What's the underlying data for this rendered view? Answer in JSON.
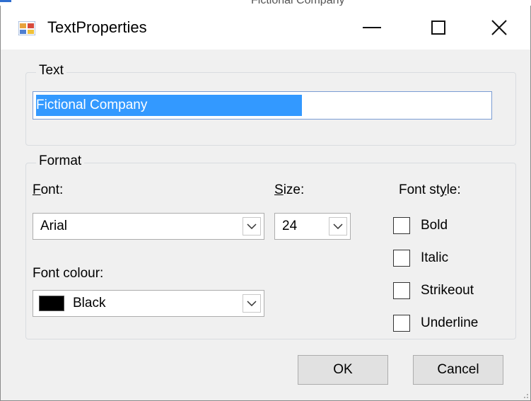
{
  "background_strip": {
    "text": "Fictional Company"
  },
  "window": {
    "title": "TextProperties",
    "controls": {
      "minimize": "minimize-icon",
      "maximize": "maximize-icon",
      "close": "close-icon"
    }
  },
  "text_group": {
    "title": "Text",
    "input_value": "Fictional Company"
  },
  "format_group": {
    "title": "Format",
    "font_label_accel": "F",
    "font_label_rest": "ont:",
    "font_value": "Arial",
    "size_label_accel": "S",
    "size_label_rest": "ize:",
    "size_value": "24",
    "colour_label": "Font colour:",
    "colour_value": "Black",
    "colour_swatch": "#000000",
    "style_label_pre": "Font st",
    "style_label_accel": "y",
    "style_label_post": "le:",
    "styles": [
      {
        "label": "Bold",
        "checked": false
      },
      {
        "label": "Italic",
        "checked": false
      },
      {
        "label": "Strikeout",
        "checked": false
      },
      {
        "label": "Underline",
        "checked": false
      }
    ]
  },
  "buttons": {
    "ok": "OK",
    "cancel": "Cancel"
  },
  "colors": {
    "selection": "#3399ff",
    "window_bg": "#f0f0f0",
    "button_bg": "#e1e1e1"
  }
}
